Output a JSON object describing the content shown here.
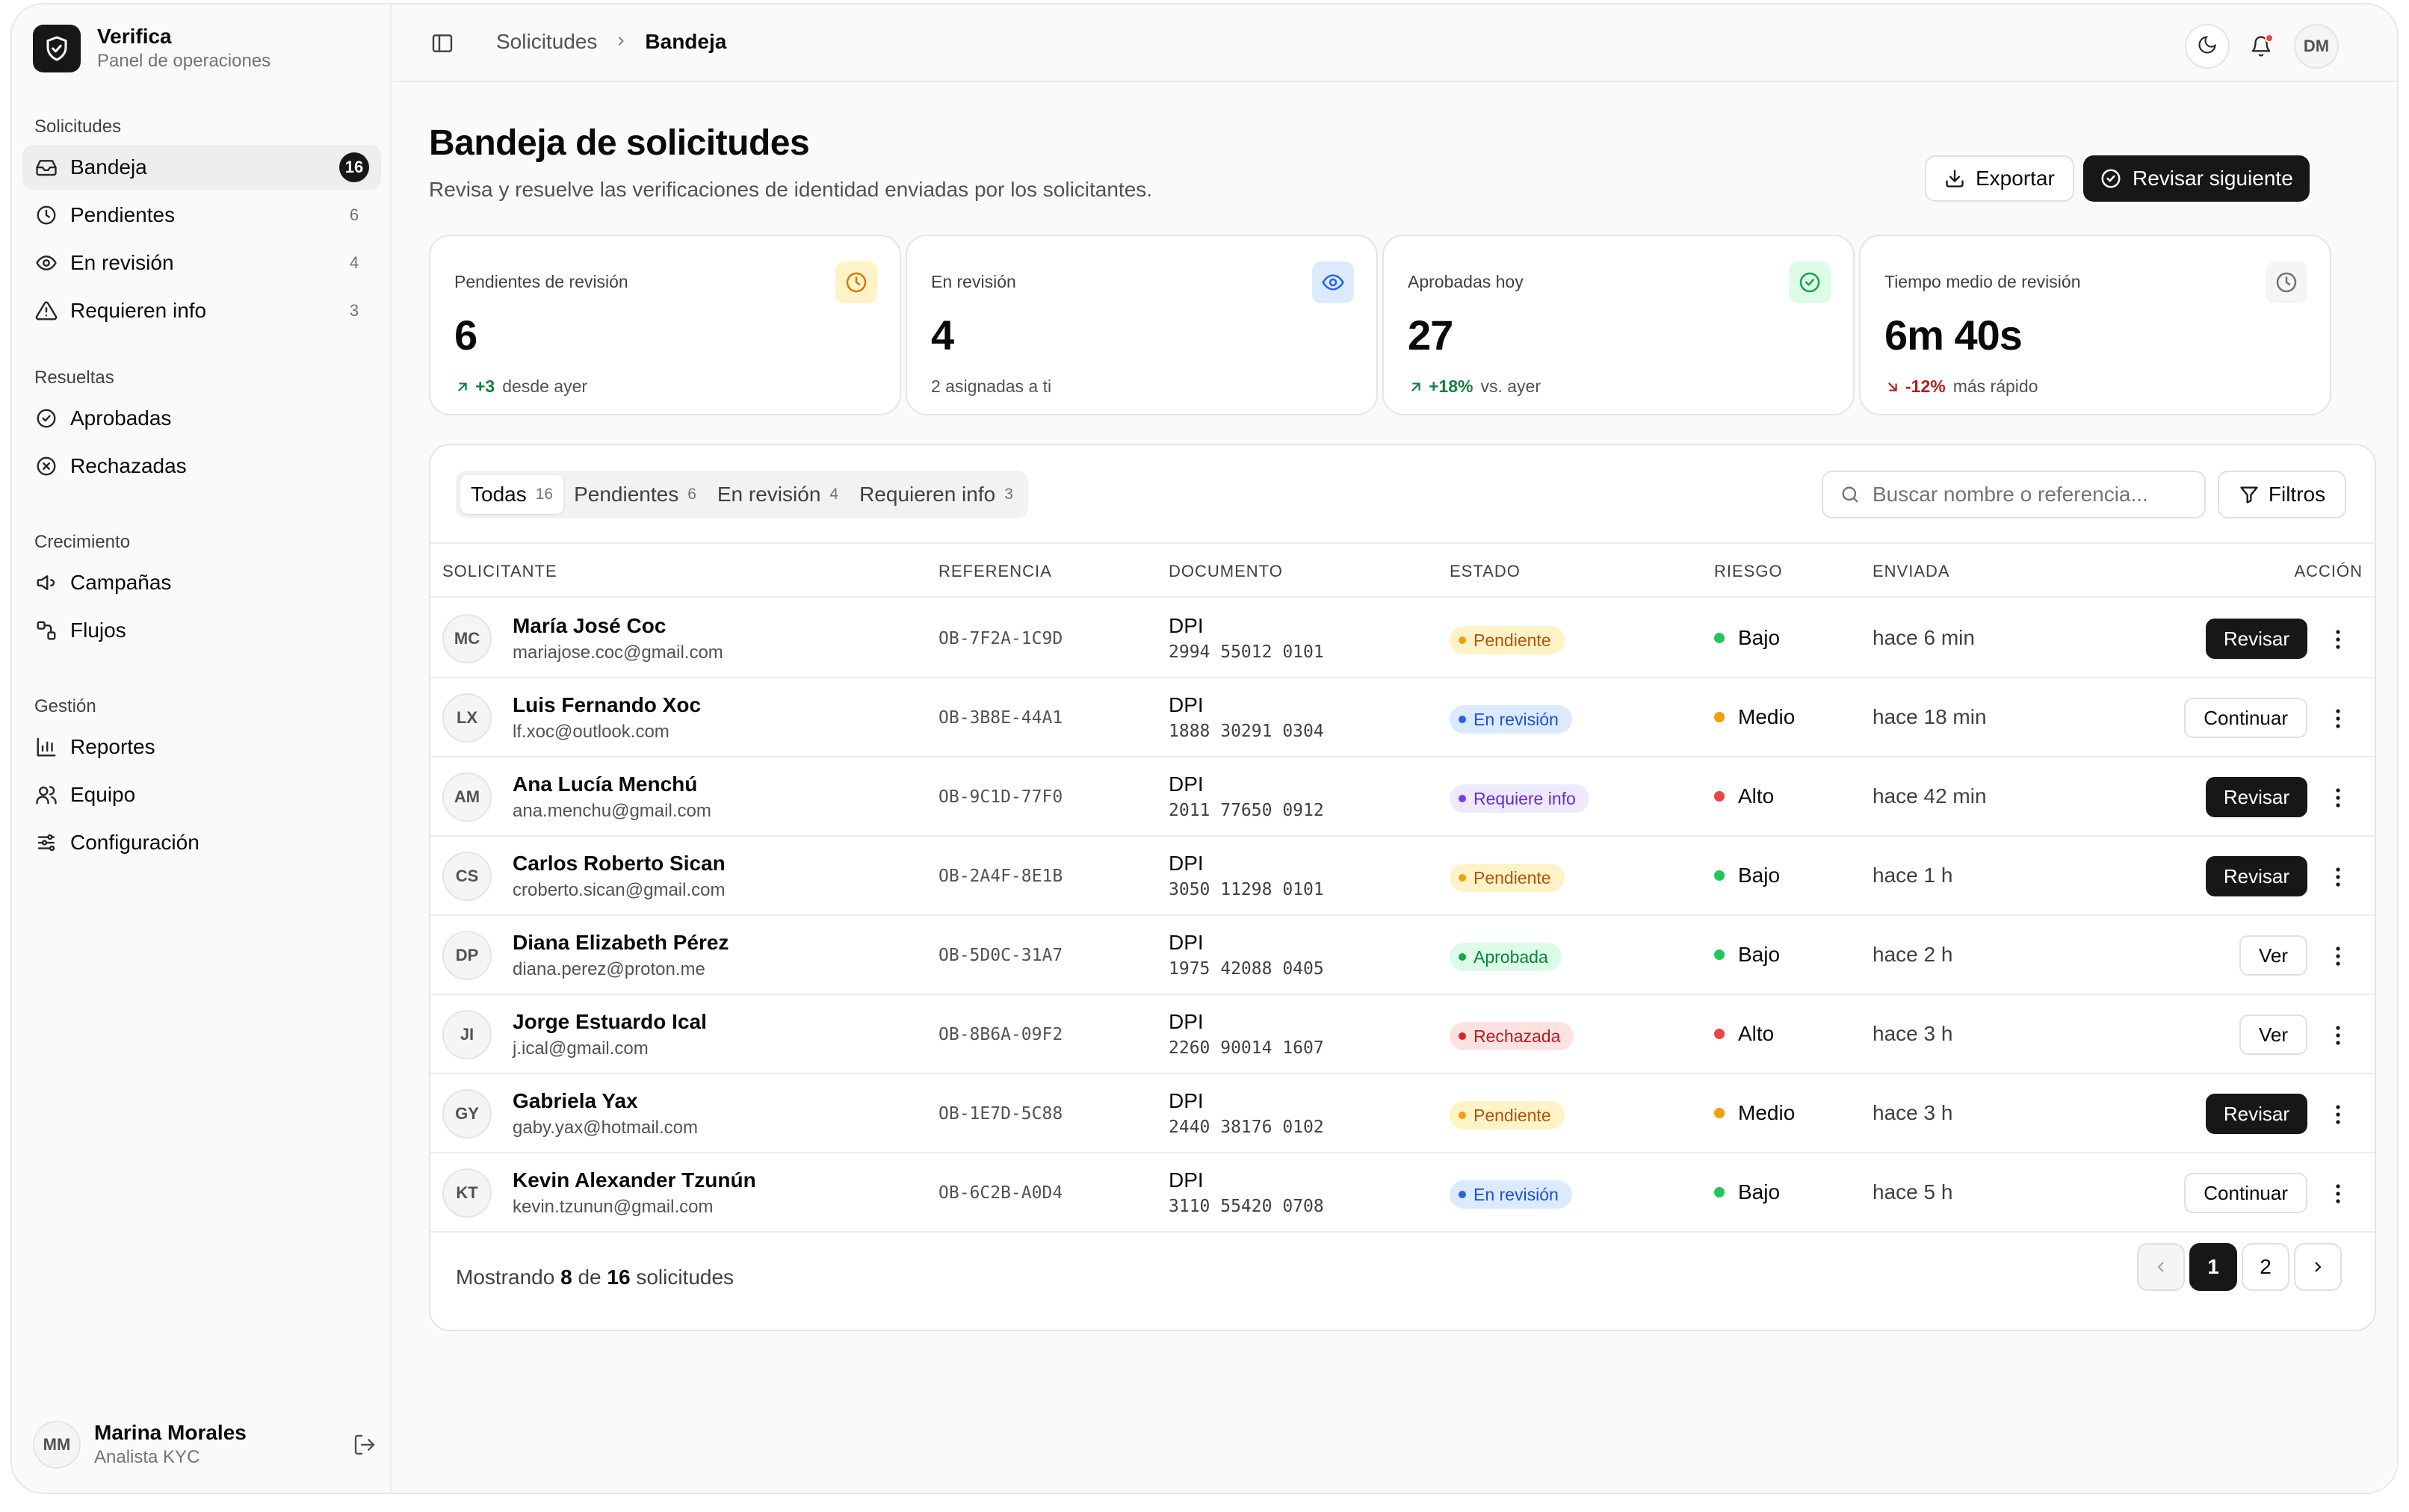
{
  "brand": {
    "name": "Verifica",
    "subtitle": "Panel de operaciones"
  },
  "sidebar": {
    "groups": [
      {
        "title": "Solicitudes",
        "items": [
          {
            "label": "Bandeja",
            "count": "16",
            "icon": "inbox-icon",
            "active": true
          },
          {
            "label": "Pendientes",
            "count": "6",
            "icon": "clock-icon"
          },
          {
            "label": "En revisión",
            "count": "4",
            "icon": "eye-icon"
          },
          {
            "label": "Requieren info",
            "count": "3",
            "icon": "warning-icon"
          }
        ]
      },
      {
        "title": "Resueltas",
        "items": [
          {
            "label": "Aprobadas",
            "icon": "check-circle-icon"
          },
          {
            "label": "Rechazadas",
            "icon": "x-circle-icon"
          }
        ]
      },
      {
        "title": "Crecimiento",
        "items": [
          {
            "label": "Campañas",
            "icon": "megaphone-icon"
          },
          {
            "label": "Flujos",
            "icon": "workflow-icon"
          }
        ]
      },
      {
        "title": "Gestión",
        "items": [
          {
            "label": "Reportes",
            "icon": "bar-chart-icon"
          },
          {
            "label": "Equipo",
            "icon": "users-icon"
          },
          {
            "label": "Configuración",
            "icon": "sliders-icon"
          }
        ]
      }
    ],
    "user": {
      "initials": "MM",
      "name": "Marina Morales",
      "role": "Analista KYC"
    }
  },
  "topbar": {
    "breadcrumb": [
      "Solicitudes",
      "Bandeja"
    ],
    "user_initials": "DM"
  },
  "page": {
    "title": "Bandeja de solicitudes",
    "subtitle": "Revisa y resuelve las verificaciones de identidad enviadas por los solicitantes.",
    "export_label": "Exportar",
    "next_label": "Revisar siguiente"
  },
  "stats": [
    {
      "label": "Pendientes de revisión",
      "value": "6",
      "delta": "+3",
      "note": "desde ayer",
      "trend": "up",
      "icon": "clock-icon",
      "icon_bg": "#fef3c7",
      "icon_color": "#d97706",
      "delta_color": "#15803d"
    },
    {
      "label": "En revisión",
      "value": "4",
      "delta": "",
      "note": "2 asignadas a ti",
      "trend": "none",
      "icon": "eye-icon",
      "icon_bg": "#dbeafe",
      "icon_color": "#2563eb",
      "delta_color": "#15803d"
    },
    {
      "label": "Aprobadas hoy",
      "value": "27",
      "delta": "+18%",
      "note": "vs. ayer",
      "trend": "up",
      "icon": "check-circle-icon",
      "icon_bg": "#dcfce7",
      "icon_color": "#16a34a",
      "delta_color": "#15803d"
    },
    {
      "label": "Tiempo medio de revisión",
      "value": "6m 40s",
      "delta": "-12%",
      "note": "más rápido",
      "trend": "down",
      "icon": "clock-icon",
      "icon_bg": "#f5f5f5",
      "icon_color": "#737373",
      "delta_color": "#b91c1c"
    }
  ],
  "tabs": [
    {
      "label": "Todas",
      "count": "16",
      "active": true
    },
    {
      "label": "Pendientes",
      "count": "6"
    },
    {
      "label": "En revisión",
      "count": "4"
    },
    {
      "label": "Requieren info",
      "count": "3"
    }
  ],
  "search": {
    "placeholder": "Buscar nombre o referencia..."
  },
  "filters_label": "Filtros",
  "table": {
    "columns": [
      "SOLICITANTE",
      "REFERENCIA",
      "DOCUMENTO",
      "ESTADO",
      "RIESGO",
      "ENVIADA",
      "ACCIÓN"
    ],
    "rows": [
      {
        "initials": "MC",
        "name": "María José Coc",
        "email": "mariajose.coc@gmail.com",
        "ref": "OB-7F2A-1C9D",
        "doc_type": "DPI",
        "doc_num": "2994 55012 0101",
        "status": "Pendiente",
        "status_kind": "pending",
        "risk": "Bajo",
        "risk_kind": "low",
        "sent": "hace 6 min",
        "action": "Revisar",
        "action_style": "dark"
      },
      {
        "initials": "LX",
        "name": "Luis Fernando Xoc",
        "email": "lf.xoc@outlook.com",
        "ref": "OB-3B8E-44A1",
        "doc_type": "DPI",
        "doc_num": "1888 30291 0304",
        "status": "En revisión",
        "status_kind": "review",
        "risk": "Medio",
        "risk_kind": "medium",
        "sent": "hace 18 min",
        "action": "Continuar",
        "action_style": "light"
      },
      {
        "initials": "AM",
        "name": "Ana Lucía Menchú",
        "email": "ana.menchu@gmail.com",
        "ref": "OB-9C1D-77F0",
        "doc_type": "DPI",
        "doc_num": "2011 77650 0912",
        "status": "Requiere info",
        "status_kind": "info",
        "risk": "Alto",
        "risk_kind": "high",
        "sent": "hace 42 min",
        "action": "Revisar",
        "action_style": "dark"
      },
      {
        "initials": "CS",
        "name": "Carlos Roberto Sican",
        "email": "croberto.sican@gmail.com",
        "ref": "OB-2A4F-8E1B",
        "doc_type": "DPI",
        "doc_num": "3050 11298 0101",
        "status": "Pendiente",
        "status_kind": "pending",
        "risk": "Bajo",
        "risk_kind": "low",
        "sent": "hace 1 h",
        "action": "Revisar",
        "action_style": "dark"
      },
      {
        "initials": "DP",
        "name": "Diana Elizabeth Pérez",
        "email": "diana.perez@proton.me",
        "ref": "OB-5D0C-31A7",
        "doc_type": "DPI",
        "doc_num": "1975 42088 0405",
        "status": "Aprobada",
        "status_kind": "approved",
        "risk": "Bajo",
        "risk_kind": "low",
        "sent": "hace 2 h",
        "action": "Ver",
        "action_style": "light"
      },
      {
        "initials": "JI",
        "name": "Jorge Estuardo Ical",
        "email": "j.ical@gmail.com",
        "ref": "OB-8B6A-09F2",
        "doc_type": "DPI",
        "doc_num": "2260 90014 1607",
        "status": "Rechazada",
        "status_kind": "rejected",
        "risk": "Alto",
        "risk_kind": "high",
        "sent": "hace 3 h",
        "action": "Ver",
        "action_style": "light"
      },
      {
        "initials": "GY",
        "name": "Gabriela Yax",
        "email": "gaby.yax@hotmail.com",
        "ref": "OB-1E7D-5C88",
        "doc_type": "DPI",
        "doc_num": "2440 38176 0102",
        "status": "Pendiente",
        "status_kind": "pending",
        "risk": "Medio",
        "risk_kind": "medium",
        "sent": "hace 3 h",
        "action": "Revisar",
        "action_style": "dark"
      },
      {
        "initials": "KT",
        "name": "Kevin Alexander Tzunún",
        "email": "kevin.tzunun@gmail.com",
        "ref": "OB-6C2B-A0D4",
        "doc_type": "DPI",
        "doc_num": "3110 55420 0708",
        "status": "En revisión",
        "status_kind": "review",
        "risk": "Bajo",
        "risk_kind": "low",
        "sent": "hace 5 h",
        "action": "Continuar",
        "action_style": "light"
      }
    ]
  },
  "footer": {
    "prefix": "Mostrando",
    "shown": "8",
    "middle": "de",
    "total": "16",
    "suffix": "solicitudes",
    "pages": [
      "1",
      "2"
    ],
    "current_page": "1"
  },
  "colors": {
    "status": {
      "pending": {
        "bg": "#fef3c7",
        "fg": "#b45309",
        "dot": "#f59e0b"
      },
      "review": {
        "bg": "#dbeafe",
        "fg": "#1d4ed8",
        "dot": "#2563eb"
      },
      "info": {
        "bg": "#ede9fe",
        "fg": "#6d28d9",
        "dot": "#7c3aed"
      },
      "approved": {
        "bg": "#dcfce7",
        "fg": "#15803d",
        "dot": "#16a34a"
      },
      "rejected": {
        "bg": "#fee2e2",
        "fg": "#b91c1c",
        "dot": "#dc2626"
      }
    },
    "risk": {
      "low": "#22c55e",
      "medium": "#f59e0b",
      "high": "#ef4444"
    }
  }
}
